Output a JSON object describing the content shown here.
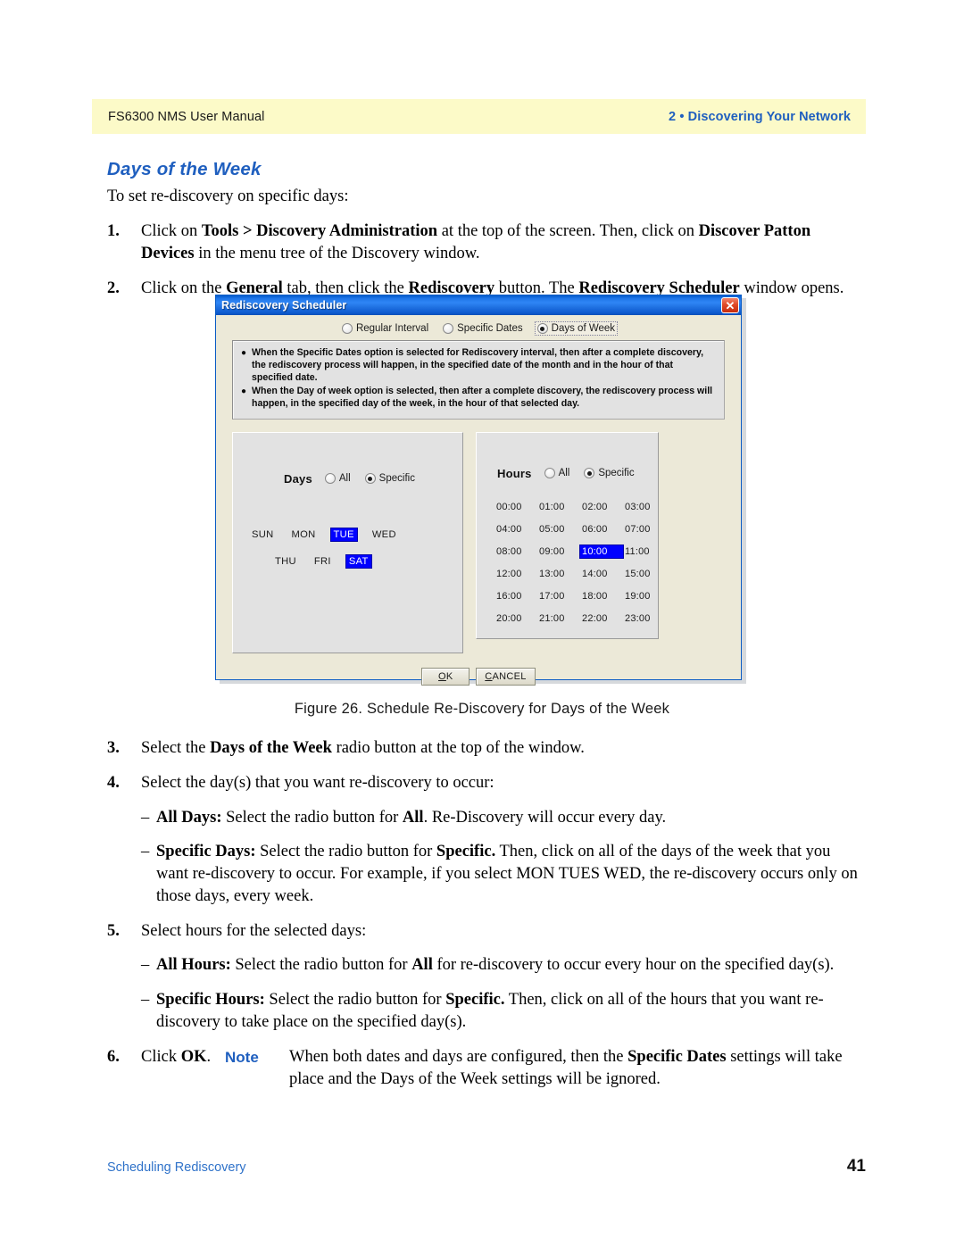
{
  "header": {
    "left": "FS6300 NMS User Manual",
    "right": "2 • Discovering Your Network"
  },
  "section": {
    "title": "Days of the Week",
    "lead": "To set re-discovery on specific days:"
  },
  "steps": {
    "n1": "1.",
    "n2": "2.",
    "n3": "3.",
    "n4": "4.",
    "n5": "5.",
    "n6": "6."
  },
  "figure": {
    "caption": "Figure 26. Schedule Re-Discovery for Days of the Week"
  },
  "note": {
    "label": "Note"
  },
  "footer": {
    "left": "Scheduling Rediscovery",
    "page": "41"
  },
  "dialog": {
    "title": "Rediscovery Scheduler",
    "close_icon": "✕",
    "modes": [
      {
        "label": "Regular Interval",
        "selected": false
      },
      {
        "label": "Specific Dates",
        "selected": false
      },
      {
        "label": "Days of Week",
        "selected": true
      }
    ],
    "info_bullets": [
      "When the Specific Dates option is selected for Rediscovery interval, then after a complete discovery, the rediscovery process will happen, in the specified date of the month and in the hour of that specified date.",
      "When the Day of week option is selected, then after a complete discovery, the rediscovery process will happen, in the specified day of the week, in the hour of that selected day."
    ],
    "days_group": {
      "title": "Days",
      "all_label": "All",
      "specific_label": "Specific",
      "selected_option": "Specific",
      "row1": [
        "SUN",
        "MON",
        "TUE",
        "WED"
      ],
      "row2": [
        "THU",
        "FRI",
        "SAT"
      ],
      "selected_days": [
        "TUE",
        "SAT"
      ]
    },
    "hours_group": {
      "title": "Hours",
      "all_label": "All",
      "specific_label": "Specific",
      "selected_option": "Specific",
      "hours": [
        "00:00",
        "01:00",
        "02:00",
        "03:00",
        "04:00",
        "05:00",
        "06:00",
        "07:00",
        "08:00",
        "09:00",
        "10:00",
        "11:00",
        "12:00",
        "13:00",
        "14:00",
        "15:00",
        "16:00",
        "17:00",
        "18:00",
        "19:00",
        "20:00",
        "21:00",
        "22:00",
        "23:00"
      ],
      "selected_hours": [
        "10:00"
      ]
    },
    "buttons": {
      "ok": "OK",
      "cancel": "CANCEL"
    }
  },
  "colors": {
    "header_band": "#fcfac8",
    "brand_blue": "#1f5fbf",
    "dialog_face": "#ece9d8",
    "selection_blue": "#0000ff",
    "titlebar_blue": "#0a62d4"
  }
}
